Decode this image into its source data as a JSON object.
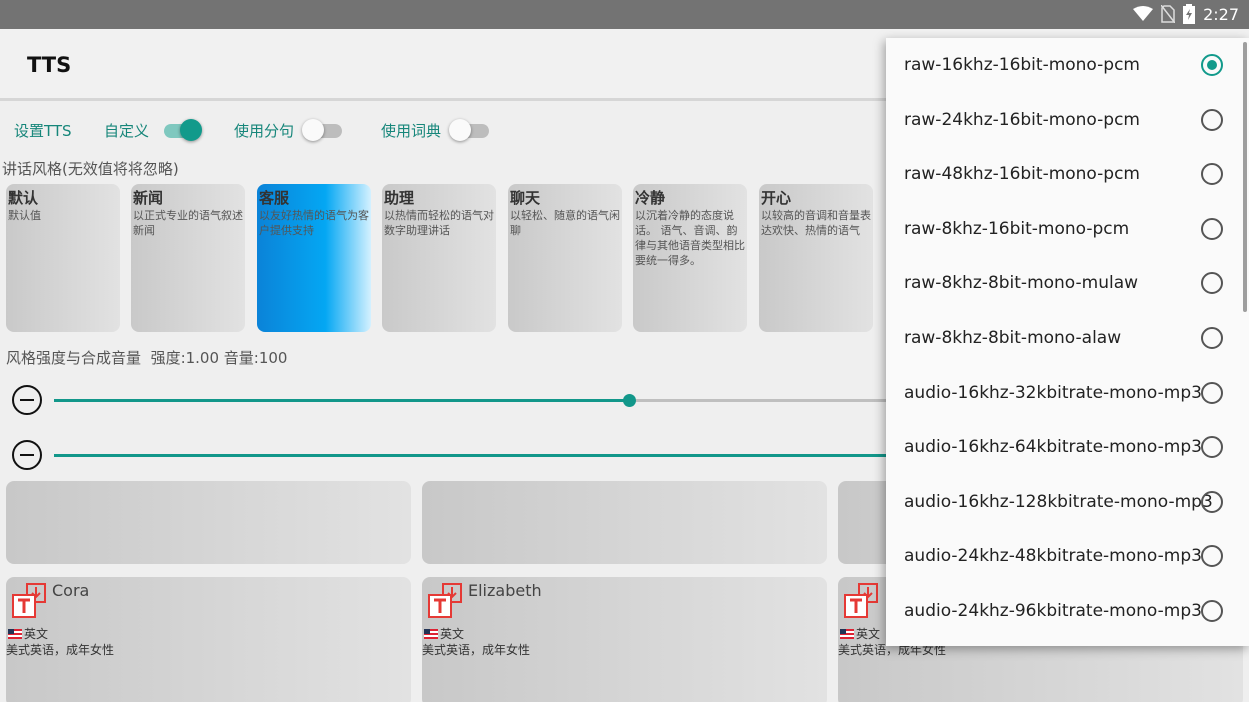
{
  "status_bar": {
    "time": "2:27"
  },
  "app_bar": {
    "title": "TTS"
  },
  "toolbar": {
    "set_tts": "设置TTS",
    "custom": {
      "label": "自定义",
      "on": true
    },
    "use_split": {
      "label": "使用分句",
      "on": false
    },
    "use_dict": {
      "label": "使用词典",
      "on": false
    }
  },
  "styles_section": {
    "label": "讲话风格(无效值将将忽略)",
    "cards": [
      {
        "title": "默认",
        "desc": "默认值",
        "selected": false
      },
      {
        "title": "新闻",
        "desc": "以正式专业的语气叙述新闻",
        "selected": false
      },
      {
        "title": "客服",
        "desc": "以友好热情的语气为客户提供支持",
        "selected": true
      },
      {
        "title": "助理",
        "desc": "以热情而轻松的语气对数字助理讲话",
        "selected": false
      },
      {
        "title": "聊天",
        "desc": "以轻松、随意的语气闲聊",
        "selected": false
      },
      {
        "title": "冷静",
        "desc": "以沉着冷静的态度说话。 语气、音调、韵律与其他语音类型相比要统一得多。",
        "selected": false
      },
      {
        "title": "开心",
        "desc": "以较高的音调和音量表达欢快、热情的语气",
        "selected": false
      }
    ]
  },
  "strength": {
    "label": "风格强度与合成音量",
    "value_text": "强度:1.00 音量:100",
    "strength_fraction": 0.65,
    "volume_fraction": 1.0
  },
  "voices": [
    {
      "name": "Cora",
      "lang": "英文",
      "desc": "美式英语，成年女性"
    },
    {
      "name": "Elizabeth",
      "lang": "英文",
      "desc": "美式英语，成年女性"
    },
    {
      "name": "",
      "lang": "英文",
      "desc": "美式英语，成年女性"
    }
  ],
  "format_dropdown": {
    "selected_index": 0,
    "options": [
      "raw-16khz-16bit-mono-pcm",
      "raw-24khz-16bit-mono-pcm",
      "raw-48khz-16bit-mono-pcm",
      "raw-8khz-16bit-mono-pcm",
      "raw-8khz-8bit-mono-mulaw",
      "raw-8khz-8bit-mono-alaw",
      "audio-16khz-32kbitrate-mono-mp3",
      "audio-16khz-64kbitrate-mono-mp3",
      "audio-16khz-128kbitrate-mono-mp3",
      "audio-24khz-48kbitrate-mono-mp3",
      "audio-24khz-96kbitrate-mono-mp3"
    ]
  },
  "colors": {
    "accent": "#129a8b",
    "selected_card": "#04a7f3",
    "status_bar": "#737373"
  },
  "icons": [
    "wifi-icon",
    "no-sim-icon",
    "battery-icon",
    "minus-circle-icon",
    "tts-voice-icon",
    "us-flag-icon",
    "radio-icon"
  ]
}
